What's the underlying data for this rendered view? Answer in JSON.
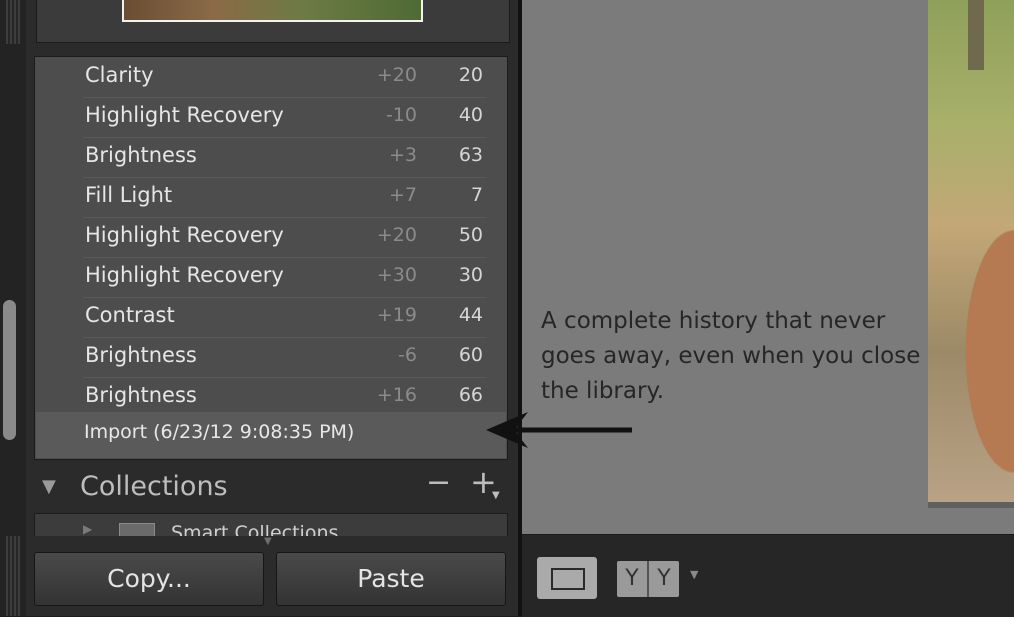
{
  "history": {
    "items": [
      {
        "name": "Clarity",
        "delta": "+20",
        "value": "20"
      },
      {
        "name": "Highlight Recovery",
        "delta": "-10",
        "value": "40"
      },
      {
        "name": "Brightness",
        "delta": "+3",
        "value": "63"
      },
      {
        "name": "Fill Light",
        "delta": "+7",
        "value": "7"
      },
      {
        "name": "Highlight Recovery",
        "delta": "+20",
        "value": "50"
      },
      {
        "name": "Highlight Recovery",
        "delta": "+30",
        "value": "30"
      },
      {
        "name": "Contrast",
        "delta": "+19",
        "value": "44"
      },
      {
        "name": "Brightness",
        "delta": "-6",
        "value": "60"
      },
      {
        "name": "Brightness",
        "delta": "+16",
        "value": "66"
      }
    ],
    "import_label": "Import (6/23/12 9:08:35 PM)"
  },
  "collections": {
    "title": "Collections",
    "minus": "−",
    "plus": "+",
    "first_item": "Smart Collections"
  },
  "buttons": {
    "copy": "Copy...",
    "paste": "Paste"
  },
  "annotation": {
    "text": "A complete history that never goes away, even when you close the library."
  },
  "toolbar": {
    "compare_left": "Y",
    "compare_right": "Y"
  },
  "colors": {
    "panel": "#2b2b2b",
    "history_bg": "#4d4d4d",
    "main_bg": "#7b7b7b"
  }
}
